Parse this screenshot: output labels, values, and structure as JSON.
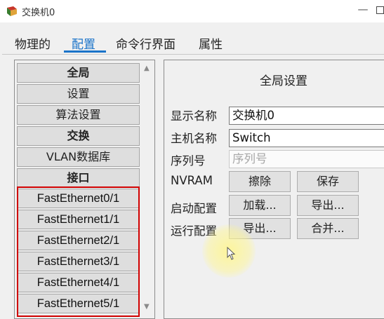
{
  "window": {
    "title": "交换机0",
    "minimize_glyph": "—"
  },
  "tabs": [
    {
      "label": "物理的",
      "active": false
    },
    {
      "label": "配置",
      "active": true
    },
    {
      "label": "命令行界面",
      "active": false
    },
    {
      "label": "属性",
      "active": false
    }
  ],
  "sidebar": {
    "items": [
      {
        "label": "全局",
        "bold": true
      },
      {
        "label": "设置",
        "bold": false
      },
      {
        "label": "算法设置",
        "bold": false
      },
      {
        "label": "交换",
        "bold": true
      },
      {
        "label": "VLAN数据库",
        "bold": false
      },
      {
        "label": "接口",
        "bold": true
      }
    ],
    "ports": [
      "FastEthernet0/1",
      "FastEthernet1/1",
      "FastEthernet2/1",
      "FastEthernet3/1",
      "FastEthernet4/1",
      "FastEthernet5/1"
    ]
  },
  "global_settings": {
    "title": "全局设置",
    "display_name_label": "显示名称",
    "display_name_value": "交换机0",
    "hostname_label": "主机名称",
    "hostname_value": "Switch",
    "serial_label": "序列号",
    "serial_placeholder": "序列号",
    "nvram_label": "NVRAM",
    "erase_button": "擦除",
    "save_button": "保存",
    "startup_label": "启动配置",
    "load_button": "加载...",
    "startup_export_button": "导出...",
    "running_label": "运行配置",
    "running_export_button": "导出...",
    "merge_button": "合并..."
  },
  "colors": {
    "accent": "#1a73c9",
    "highlight_box": "#d00000",
    "panel_bg": "#f0f0f0"
  }
}
